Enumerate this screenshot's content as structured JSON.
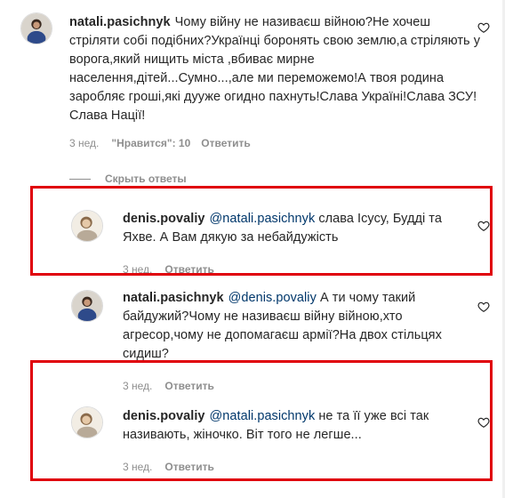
{
  "comments": [
    {
      "username": "natali.pasichnyk",
      "mention": "",
      "text": "Чому війну не називаєш війною?Не хочеш стріляти собі подібних?Українці боронять свою землю,а стріляють у ворога,який нищить міста ,вбиває мирне населення,дітей...Сумно...,але ми переможемо!А твоя родина заробляє гроші,які дууже огидно пахнуть!Слава Україні!Слава ЗСУ!Слава Нації!",
      "time": "3 нед.",
      "likes": "\"Нравится\": 10",
      "reply": "Ответить",
      "avatar_icon": "profile-photo-icon"
    }
  ],
  "hide_replies_label": "Скрыть ответы",
  "replies": [
    {
      "username": "denis.povaliy",
      "mention": "@natali.pasichnyk",
      "text": " слава Ісусу, Будді та Яхве. А Вам дякую за небайдужість",
      "time": "3 нед.",
      "reply": "Ответить"
    },
    {
      "username": "natali.pasichnyk",
      "mention": "@denis.povaliy",
      "text": " А ти чому такий байдужий?Чому не називаєш війну війною,хто агресор,чому не допомагаєш армії?На двох стільцях сидиш?",
      "time": "3 нед.",
      "reply": "Ответить"
    },
    {
      "username": "denis.povaliy",
      "mention": "@natali.pasichnyk",
      "text": " не та її уже всі так називають, жіночко. Віт того не легше...",
      "time": "3 нед.",
      "reply": "Ответить"
    }
  ],
  "colors": {
    "highlight": "#e0000a",
    "mention": "#00376b",
    "secondary_text": "#8e8e8e"
  }
}
